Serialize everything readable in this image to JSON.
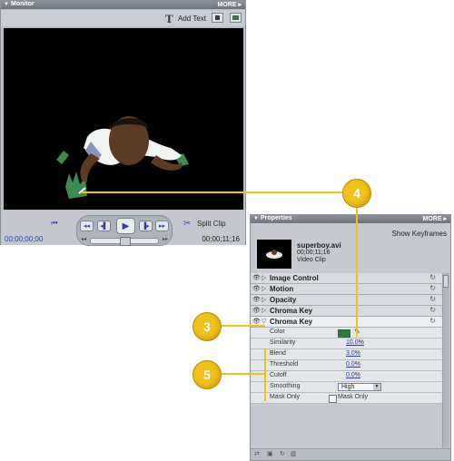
{
  "monitor": {
    "title": "Monitor",
    "more": "MORE",
    "add_text": "Add Text",
    "timecode_left": "00;00;00;00",
    "timecode_right": "00;00;11;16",
    "split_clip": "Split Clip"
  },
  "properties": {
    "title": "Properties",
    "more": "MORE",
    "show_keyframes": "Show Keyframes",
    "clip": {
      "name": "superboy.avi",
      "duration": "00;00;11;16",
      "type": "Video Clip"
    },
    "effects": [
      {
        "name": "Image Control",
        "expanded": false
      },
      {
        "name": "Motion",
        "expanded": false
      },
      {
        "name": "Opacity",
        "expanded": false
      },
      {
        "name": "Chroma Key",
        "expanded": false
      },
      {
        "name": "Chroma Key",
        "expanded": true
      }
    ],
    "params": {
      "color_label": "Color",
      "color_value": "#2f7a3a",
      "similarity_label": "Similarity",
      "similarity_value": "10.0",
      "blend_label": "Blend",
      "blend_value": "3.0",
      "threshold_label": "Threshold",
      "threshold_value": "0.0",
      "cutoff_label": "Cutoff",
      "cutoff_value": "0.0",
      "unit": "%",
      "smoothing_label": "Smoothing",
      "smoothing_value": "High",
      "mask_only_label": "Mask Only",
      "mask_only_checkbox_label": "Mask Only"
    }
  },
  "callouts": {
    "c3": "3",
    "c4": "4",
    "c5": "5"
  },
  "colors": {
    "callout": "#f0c21d",
    "key_color": "#2f7a3a",
    "link_blue": "#2a3fa8"
  }
}
